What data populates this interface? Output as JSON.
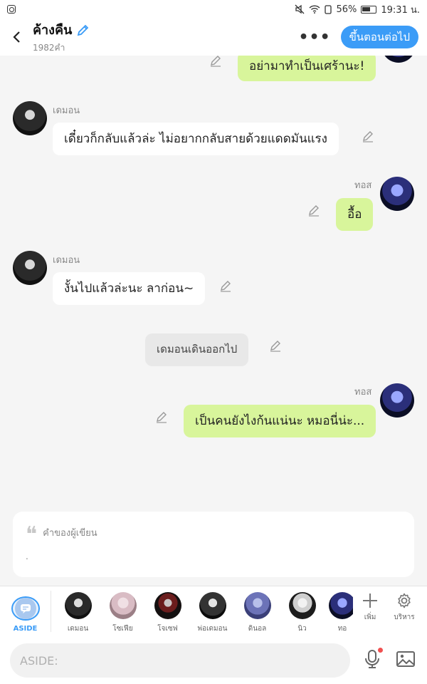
{
  "status_bar": {
    "battery": "56%",
    "time": "19:31 น."
  },
  "header": {
    "title": "ค้างคืน",
    "subtitle": "1982คำ",
    "next_button": "ขึ้นตอนต่อไป"
  },
  "messages": [
    {
      "side": "right",
      "speaker": "",
      "text": "อย่ามาทำเป็นเศร้านะ!"
    },
    {
      "side": "left",
      "speaker": "เดมอน",
      "text": "เดี๋ยวก็กลับแล้วล่ะ ไม่อยากกลับสายด้วยแดดมันแรง"
    },
    {
      "side": "right",
      "speaker": "ทอส",
      "text": "อื้อ"
    },
    {
      "side": "left",
      "speaker": "เดมอน",
      "text": "งั้นไปแล้วล่ะนะ ลาก่อน~"
    },
    {
      "side": "narration",
      "speaker": "",
      "text": "เดมอนเดินออกไป"
    },
    {
      "side": "right",
      "speaker": "ทอส",
      "text": "เป็นคนยังไงก้นแน่นะ หมอนี่น่ะ..."
    }
  ],
  "writer_note": {
    "title": "คำของผู้เขียน",
    "body": "."
  },
  "characters": {
    "aside_label": "ASIDE",
    "items": [
      "เดมอน",
      "โซเฟีย",
      "โจเซฟ",
      "พ่อเดมอน",
      "ดินอล",
      "นิว",
      "ทอ"
    ],
    "add_label": "เพิ่ม",
    "manage_label": "บริหาร"
  },
  "input": {
    "placeholder": "ASIDE:"
  },
  "colors": {
    "accent": "#3b9cf7",
    "right_bubble": "#d8f59b",
    "left_bubble": "#ffffff"
  }
}
